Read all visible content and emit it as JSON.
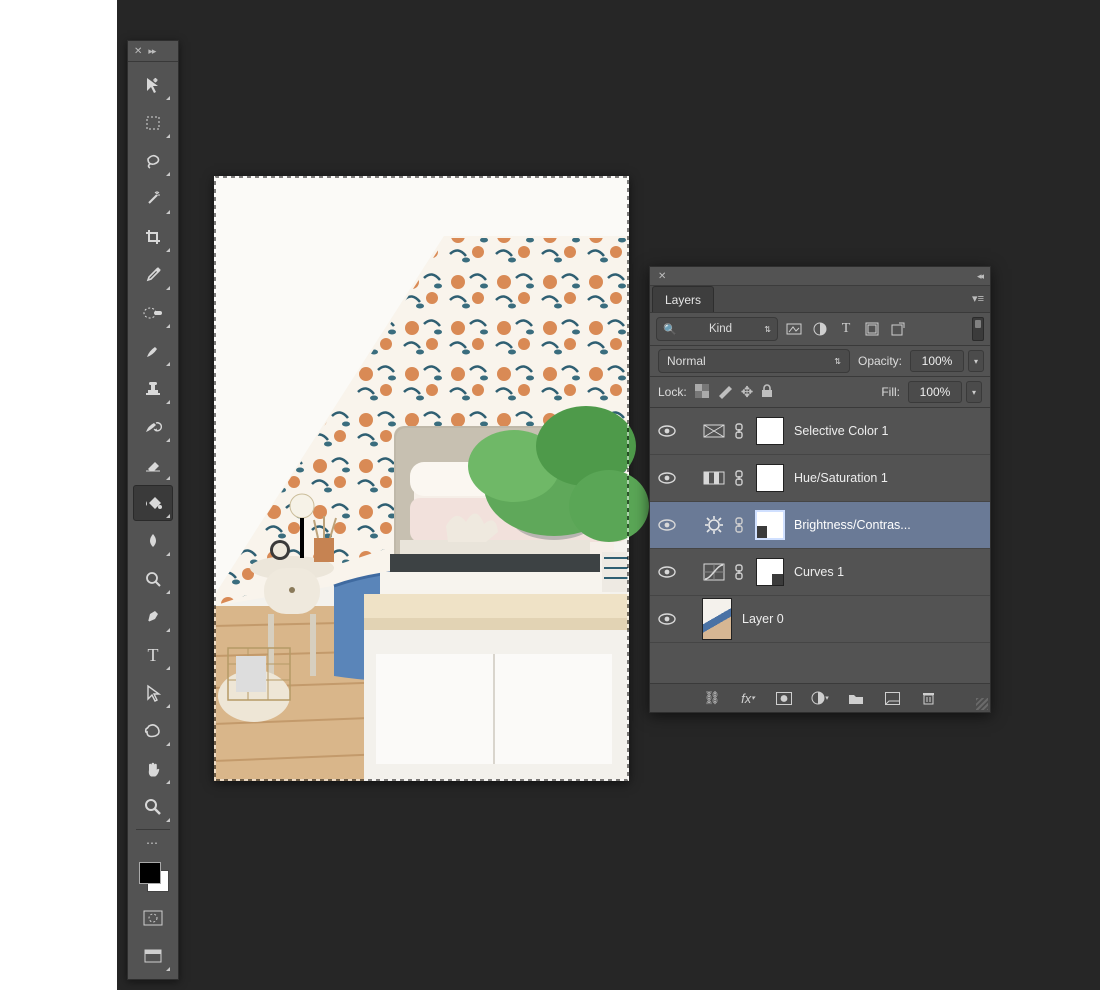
{
  "layers_panel": {
    "tab_label": "Layers",
    "filter_kind": "Kind",
    "blend_mode": "Normal",
    "opacity_label": "Opacity:",
    "opacity_value": "100%",
    "lock_label": "Lock:",
    "fill_label": "Fill:",
    "fill_value": "100%",
    "layers": [
      {
        "name": "Selective Color 1",
        "type": "selective-color",
        "mask": "plain",
        "selected": false
      },
      {
        "name": "Hue/Saturation 1",
        "type": "hue-saturation",
        "mask": "plain",
        "selected": false
      },
      {
        "name": "Brightness/Contras...",
        "type": "brightness-contrast",
        "mask": "bottom-left-dark",
        "selected": true
      },
      {
        "name": "Curves 1",
        "type": "curves",
        "mask": "bottom-right-dark",
        "selected": false
      },
      {
        "name": "Layer 0",
        "type": "image",
        "mask": "none",
        "selected": false
      }
    ],
    "footer_icon_names": [
      "link",
      "fx",
      "mask",
      "adjustment",
      "group",
      "new-layer",
      "trash"
    ]
  },
  "tools": [
    "move",
    "marquee",
    "lasso",
    "magic-wand",
    "crop",
    "eyedropper",
    "healing-brush",
    "brush",
    "clone-stamp",
    "history-brush",
    "eraser",
    "paint-bucket",
    "blur",
    "dodge",
    "pen",
    "type",
    "path-selection",
    "custom-shape",
    "hand",
    "zoom"
  ],
  "selected_tool_index": 11,
  "tool_extras": [
    "expand-row",
    "foreground-background",
    "quick-mask",
    "screen-mode"
  ]
}
